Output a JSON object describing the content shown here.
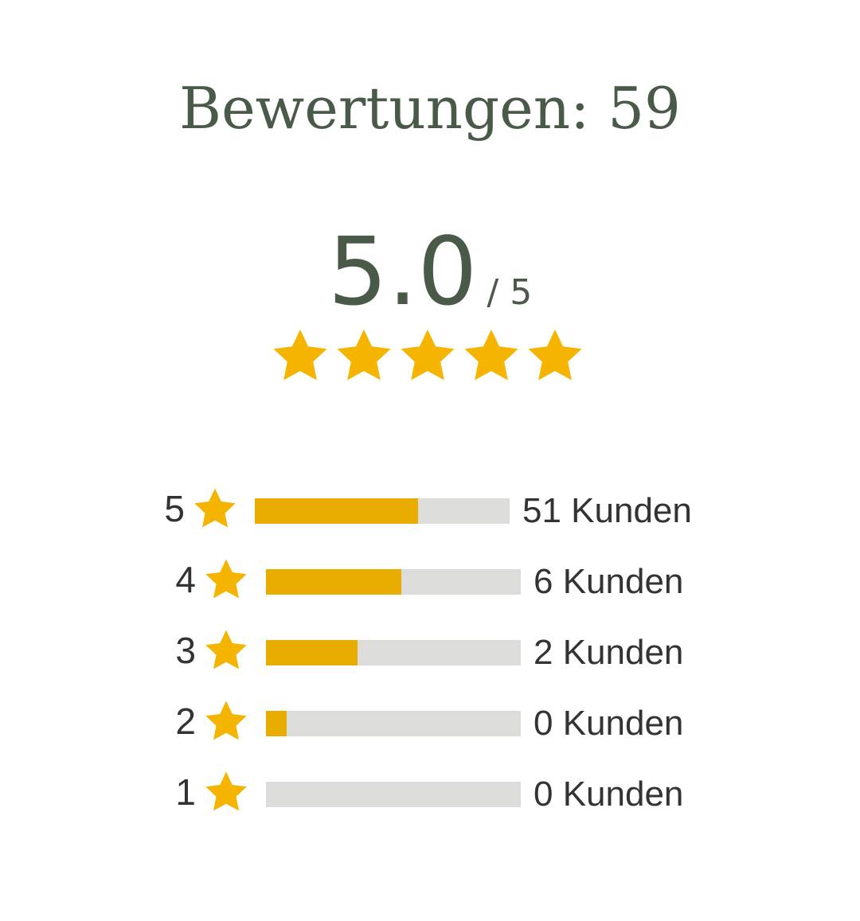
{
  "header": {
    "title": "Bewertungen: 59"
  },
  "summary": {
    "score": "5.0",
    "score_max": "/ 5",
    "stars": 5
  },
  "colors": {
    "accent_star": "#f4b400",
    "bar_fill": "#e8ad00",
    "bar_track": "#dcdddb",
    "heading_text": "#4a5a48"
  },
  "breakdown": [
    {
      "stars": "5",
      "count_label": "51 Kunden",
      "fill_fraction": 0.64
    },
    {
      "stars": "4",
      "count_label": "6 Kunden",
      "fill_fraction": 0.53
    },
    {
      "stars": "3",
      "count_label": "2 Kunden",
      "fill_fraction": 0.36
    },
    {
      "stars": "2",
      "count_label": "0 Kunden",
      "fill_fraction": 0.08
    },
    {
      "stars": "1",
      "count_label": "0 Kunden",
      "fill_fraction": 0.0
    }
  ]
}
